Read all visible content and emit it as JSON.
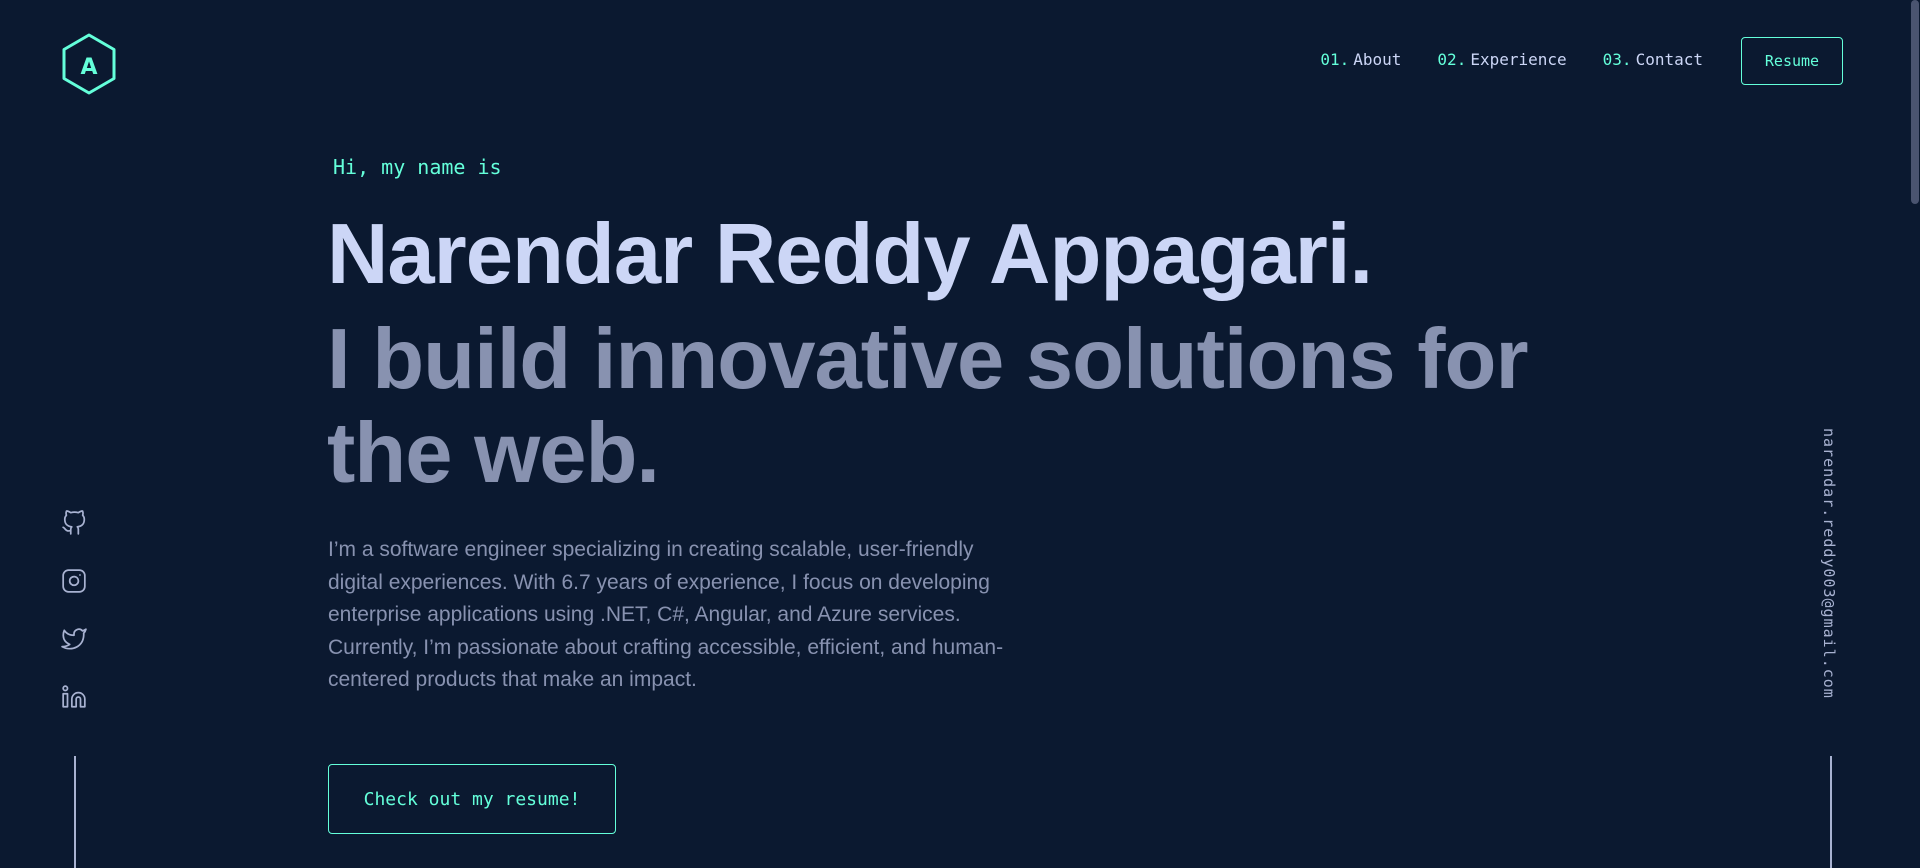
{
  "colors": {
    "background": "#0b1930",
    "accent": "#64ffda",
    "heading": "#ccd6f6",
    "body_text": "#8892b0"
  },
  "header": {
    "logo_letter": "A",
    "nav": [
      {
        "num": "01.",
        "label": "About"
      },
      {
        "num": "02.",
        "label": "Experience"
      },
      {
        "num": "03.",
        "label": "Contact"
      }
    ],
    "resume_label": "Resume"
  },
  "hero": {
    "greeting": "Hi, my name is",
    "name": "Narendar Reddy Appagari.",
    "tagline": "I build innovative solutions for the web.",
    "bio": "I’m a software engineer specializing in creating scalable, user-friendly digital experiences. With 6.7 years of experience, I focus on developing enterprise applications using .NET, C#, Angular, and Azure services. Currently, I’m passionate about crafting accessible, efficient, and human-centered products that make an impact.",
    "cta_label": "Check out my resume!"
  },
  "social": {
    "icons": [
      "github-icon",
      "instagram-icon",
      "twitter-icon",
      "linkedin-icon"
    ]
  },
  "email": "narendar.reddy003@gmail.com"
}
